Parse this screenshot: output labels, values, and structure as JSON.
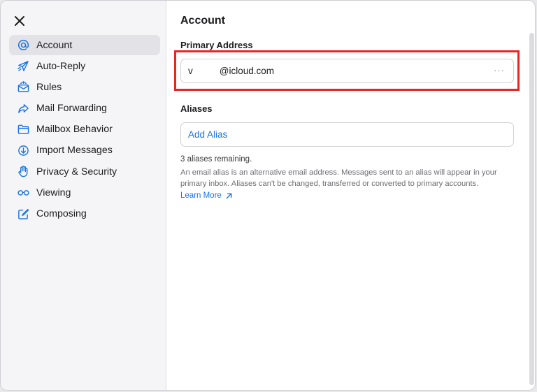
{
  "sidebar": {
    "items": [
      {
        "label": "Account",
        "icon": "at-icon",
        "active": true
      },
      {
        "label": "Auto-Reply",
        "icon": "paper-plane-icon"
      },
      {
        "label": "Rules",
        "icon": "envelope-rules-icon"
      },
      {
        "label": "Mail Forwarding",
        "icon": "forward-arrow-icon"
      },
      {
        "label": "Mailbox Behavior",
        "icon": "folder-icon"
      },
      {
        "label": "Import Messages",
        "icon": "download-circle-icon"
      },
      {
        "label": "Privacy & Security",
        "icon": "hand-icon"
      },
      {
        "label": "Viewing",
        "icon": "glasses-icon"
      },
      {
        "label": "Composing",
        "icon": "compose-icon"
      }
    ]
  },
  "main": {
    "title": "Account",
    "primary_address": {
      "heading": "Primary Address",
      "username": "v",
      "domain": "@icloud.com",
      "more": "···"
    },
    "aliases": {
      "heading": "Aliases",
      "add_label": "Add Alias",
      "remaining": "3 aliases remaining.",
      "description": "An email alias is an alternative email address. Messages sent to an alias will appear in your primary inbox. Aliases can't be changed, transferred or converted to primary accounts.",
      "learn_more": "Learn More"
    }
  },
  "colors": {
    "accent": "#1a73e8",
    "highlight": "#e8261e",
    "sidebar_bg": "#f5f5f7",
    "active_bg": "#e3e3e7"
  }
}
